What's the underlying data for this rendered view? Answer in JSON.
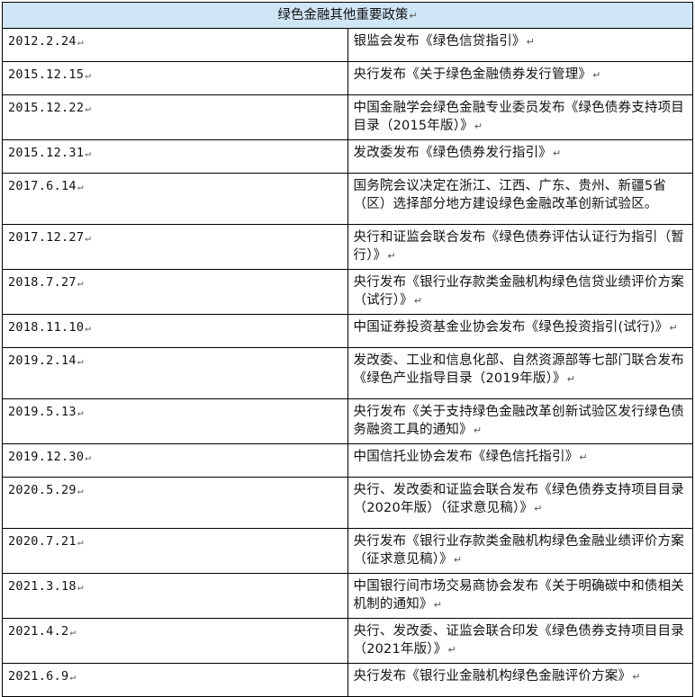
{
  "table": {
    "title": "绿色金融其他重要政策",
    "rows": [
      {
        "date": "2012.2.24",
        "text": "银监会发布《绿色信贷指引》"
      },
      {
        "date": "2015.12.15",
        "text": "央行发布《关于绿色金融债券发行管理》"
      },
      {
        "date": "2015.12.22",
        "text": "中国金融学会绿色金融专业委员发布《绿色债券支持项目目录（2015年版）》"
      },
      {
        "date": "2015.12.31",
        "text": "发改委发布《绿色债券发行指引》"
      },
      {
        "date": "2017.6.14",
        "text": "国务院会议决定在浙江、江西、广东、贵州、新疆5省（区）选择部分地方建设绿色金融改革创新试验区。"
      },
      {
        "date": "2017.12.27",
        "text": "央行和证监会联合发布《绿色债券评估认证行为指引（暂行）》"
      },
      {
        "date": "2018.7.27",
        "text": "央行发布《银行业存款类金融机构绿色信贷业绩评价方案（试行）》"
      },
      {
        "date": "2018.11.10",
        "text": "中国证券投资基金业协会发布《绿色投资指引(试行)》"
      },
      {
        "date": "2019.2.14",
        "text": "发改委、工业和信息化部、自然资源部等七部门联合发布《绿色产业指导目录（2019年版）》"
      },
      {
        "date": "2019.5.13",
        "text": "央行发布《关于支持绿色金融改革创新试验区发行绿色债务融资工具的通知》"
      },
      {
        "date": "2019.12.30",
        "text": "中国信托业协会发布《绿色信托指引》"
      },
      {
        "date": "2020.5.29",
        "text": "央行、发改委和证监会联合发布《绿色债券支持项目目录（2020年版）（征求意见稿）》"
      },
      {
        "date": "2020.7.21",
        "text": "央行发布《银行业存款类金融机构绿色金融业绩评价方案（征求意见稿）》"
      },
      {
        "date": "2021.3.18",
        "text": "中国银行间市场交易商协会发布《关于明确碳中和债相关机制的通知》"
      },
      {
        "date": "2021.4.2",
        "text": "央行、发改委、证监会联合印发《绿色债券支持项目目录（2021年版）》"
      },
      {
        "date": "2021.6.9",
        "text": "央行发布《银行业金融机构绿色金融评价方案》"
      }
    ]
  }
}
